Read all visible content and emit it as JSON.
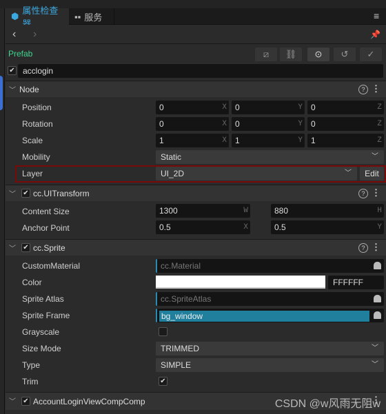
{
  "tabs": [
    {
      "label": "属性检查器",
      "icon": "inspector-icon",
      "active": true
    },
    {
      "label": "服务",
      "icon": "services-icon",
      "active": false
    }
  ],
  "prefab": {
    "label": "Prefab",
    "tools": [
      "edit-icon",
      "unlink-icon",
      "locate-icon",
      "revert-icon",
      "apply-icon"
    ]
  },
  "node_name": {
    "value": "acclogin",
    "enabled": true
  },
  "node": {
    "title": "Node",
    "position": {
      "label": "Position",
      "x": "0",
      "y": "0",
      "z": "0"
    },
    "rotation": {
      "label": "Rotation",
      "x": "0",
      "y": "0",
      "z": "0"
    },
    "scale": {
      "label": "Scale",
      "x": "1",
      "y": "1",
      "z": "1"
    },
    "mobility": {
      "label": "Mobility",
      "value": "Static"
    },
    "layer": {
      "label": "Layer",
      "value": "UI_2D",
      "edit": "Edit"
    }
  },
  "axes": {
    "x": "X",
    "y": "Y",
    "z": "Z",
    "w": "W",
    "h": "H"
  },
  "uitransform": {
    "title": "cc.UITransform",
    "content_size": {
      "label": "Content Size",
      "w": "1300",
      "h": "880"
    },
    "anchor": {
      "label": "Anchor Point",
      "x": "0.5",
      "y": "0.5"
    }
  },
  "sprite": {
    "title": "cc.Sprite",
    "custom_material": {
      "label": "CustomMaterial",
      "value": "cc.Material"
    },
    "color": {
      "label": "Color",
      "hex": "FFFFFF",
      "swatch": "#ffffff"
    },
    "sprite_atlas": {
      "label": "Sprite Atlas",
      "value": "cc.SpriteAtlas"
    },
    "sprite_frame": {
      "label": "Sprite Frame",
      "value": "bg_window"
    },
    "grayscale": {
      "label": "Grayscale",
      "checked": false
    },
    "size_mode": {
      "label": "Size Mode",
      "value": "TRIMMED"
    },
    "type": {
      "label": "Type",
      "value": "SIMPLE"
    },
    "trim": {
      "label": "Trim",
      "checked": true
    }
  },
  "component": {
    "title": "AccountLoginViewCompComp"
  },
  "watermark": "CSDN @w风雨无阻w",
  "colors": {
    "accent": "#3ca8e0",
    "prefab": "#3fd68f",
    "highlight": "#7a0a0a",
    "selected": "#1f7f9c"
  }
}
